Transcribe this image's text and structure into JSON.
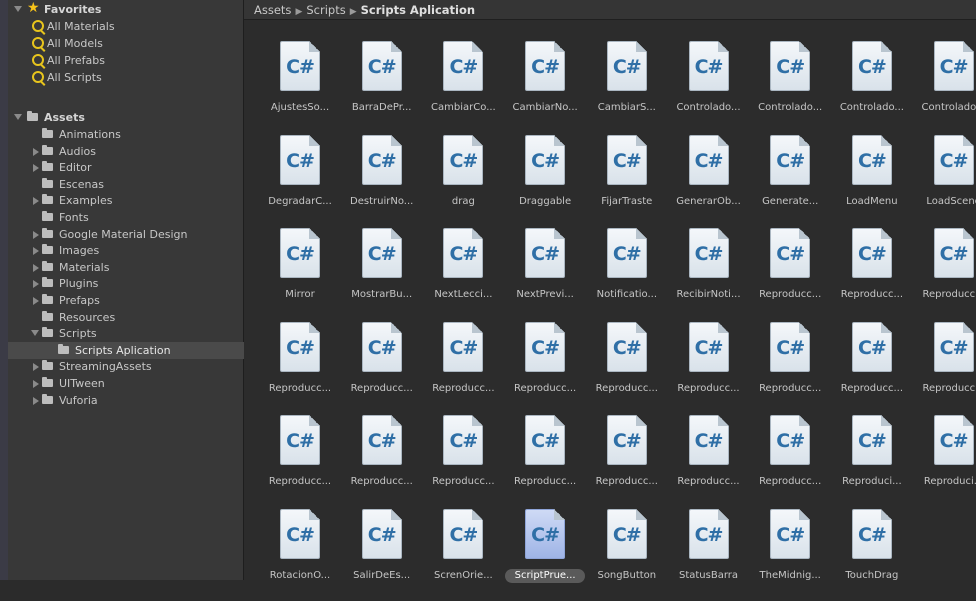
{
  "sidebar": {
    "favorites_label": "Favorites",
    "favorites": [
      "All Materials",
      "All Models",
      "All Prefabs",
      "All Scripts"
    ],
    "assets_label": "Assets",
    "folders": [
      {
        "label": "Animations",
        "expandable": false
      },
      {
        "label": "Audios",
        "expandable": true
      },
      {
        "label": "Editor",
        "expandable": true
      },
      {
        "label": "Escenas",
        "expandable": false
      },
      {
        "label": "Examples",
        "expandable": true
      },
      {
        "label": "Fonts",
        "expandable": false
      },
      {
        "label": "Google Material Design",
        "expandable": true
      },
      {
        "label": "Images",
        "expandable": true
      },
      {
        "label": "Materials",
        "expandable": true
      },
      {
        "label": "Plugins",
        "expandable": true
      },
      {
        "label": "Prefaps",
        "expandable": true
      },
      {
        "label": "Resources",
        "expandable": false
      },
      {
        "label": "Scripts",
        "expandable": true,
        "expanded": true
      },
      {
        "label": "Scripts Aplication",
        "child": true,
        "selected": true
      },
      {
        "label": "StreamingAssets",
        "expandable": true
      },
      {
        "label": "UITween",
        "expandable": true
      },
      {
        "label": "Vuforia",
        "expandable": true
      }
    ]
  },
  "breadcrumb": {
    "items": [
      "Assets",
      "Scripts"
    ],
    "current": "Scripts Aplication",
    "separator": "▶"
  },
  "assets": [
    "AjustesSo...",
    "BarraDePr...",
    "CambiarCo...",
    "CambiarNo...",
    "CambiarS...",
    "Controlado...",
    "Controlado...",
    "Controlado...",
    "Controlado...",
    "DegradarC...",
    "DestruirNo...",
    "drag",
    "Draggable",
    "FijarTraste",
    "GenerarOb...",
    "Generate...",
    "LoadMenu",
    "LoadScene",
    "Mirror",
    "MostrarBu...",
    "NextLecci...",
    "NextPrevi...",
    "Notificatio...",
    "RecibirNoti...",
    "Reproducc...",
    "Reproducc...",
    "Reproducc...",
    "Reproducc...",
    "Reproducc...",
    "Reproducc...",
    "Reproducc...",
    "Reproducc...",
    "Reproducc...",
    "Reproducc...",
    "Reproducc...",
    "Reproducc...",
    "Reproducc...",
    "Reproducc...",
    "Reproducc...",
    "Reproducc...",
    "Reproducc...",
    "Reproducc...",
    "Reproducc...",
    "Reproduci...",
    "Reproduci...",
    "RotacionO...",
    "SalirDeEs...",
    "ScrenOrie...",
    "ScriptPrue...",
    "SongButton",
    "StatusBarra",
    "TheMidnig...",
    "TouchDrag"
  ],
  "selected_asset": "ScriptPrue...",
  "icon_glyph": "C#",
  "colors": {
    "panel_bg": "#2c2c2c",
    "sidebar_bg": "#383838",
    "favorite_star": "#f7c31a",
    "search_icon": "#e8c51d",
    "cs_text": "#2f6fa6"
  }
}
